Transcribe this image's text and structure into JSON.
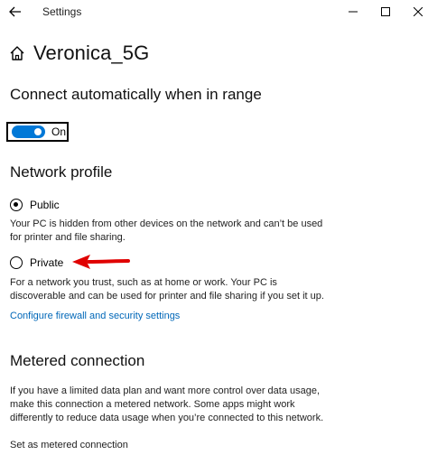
{
  "window": {
    "title": "Settings",
    "back_icon": "back-arrow-icon",
    "minimize_icon": "minimize-icon",
    "maximize_icon": "maximize-icon",
    "close_icon": "close-icon"
  },
  "header": {
    "icon": "home-icon",
    "title": "Veronica_5G"
  },
  "auto_connect": {
    "heading": "Connect automatically when in range",
    "toggle_state": "On",
    "accent_color": "#0078d7"
  },
  "network_profile": {
    "heading": "Network profile",
    "options": [
      {
        "label": "Public",
        "selected": true,
        "description_lines": [
          "Your PC is hidden from other devices on the network and can’t be used",
          "for printer and file sharing."
        ]
      },
      {
        "label": "Private",
        "selected": false,
        "description_lines": [
          "For a network you trust, such as at home or work. Your PC is",
          "discoverable and can be used for printer and file sharing if you set it up."
        ]
      }
    ],
    "link": "Configure firewall and security settings",
    "annotation_arrow_color": "#e00000"
  },
  "metered": {
    "heading": "Metered connection",
    "description_lines": [
      "If you have a limited data plan and want more control over data usage,",
      "make this connection a metered network. Some apps might work",
      "differently to reduce data usage when you’re connected to this network."
    ],
    "setting_label": "Set as metered connection"
  }
}
